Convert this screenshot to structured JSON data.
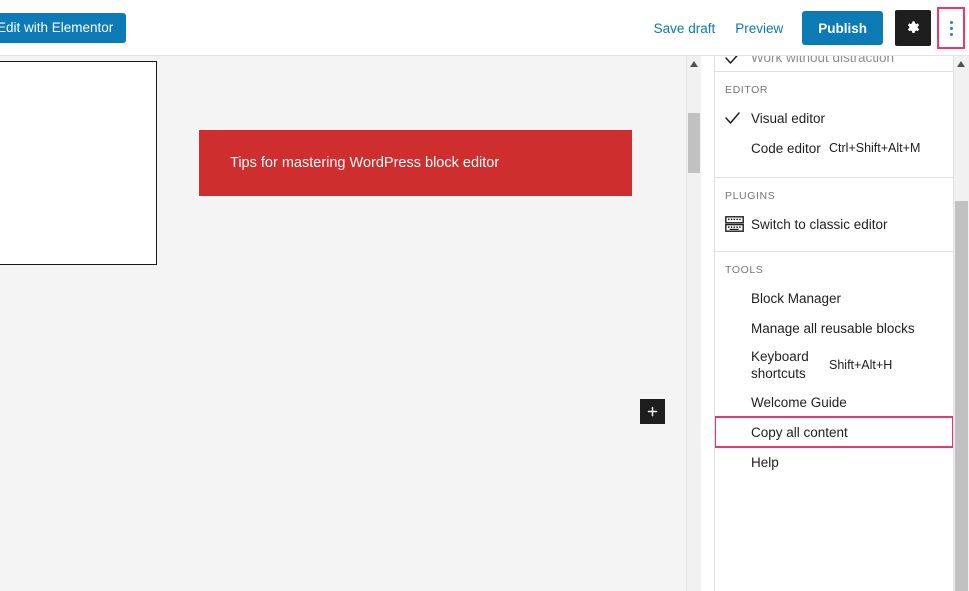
{
  "topbar": {
    "elementor_button": "Edit with Elementor",
    "save_draft": "Save draft",
    "preview": "Preview",
    "publish": "Publish",
    "settings_icon": "gear-icon",
    "more_menu_icon": "kebab-menu-icon"
  },
  "canvas": {
    "banner_text": "Tips for mastering WordPress block editor",
    "banner_color": "#cf2e2e",
    "background_color": "#f4f4f4",
    "add_block_icon": "plus-icon"
  },
  "menu": {
    "view_item": {
      "label": "Work without distraction",
      "checked": true
    },
    "sections": [
      {
        "title": "EDITOR",
        "items": [
          {
            "label": "Visual editor",
            "checked": true,
            "shortcut": ""
          },
          {
            "label": "Code editor",
            "checked": false,
            "shortcut": "Ctrl+Shift+Alt+M"
          }
        ]
      },
      {
        "title": "PLUGINS",
        "items": [
          {
            "label": "Switch to classic editor",
            "icon": "classic-editor-icon",
            "shortcut": ""
          }
        ]
      },
      {
        "title": "TOOLS",
        "items": [
          {
            "label": "Block Manager",
            "shortcut": ""
          },
          {
            "label": "Manage all reusable blocks",
            "shortcut": ""
          },
          {
            "label": "Keyboard shortcuts",
            "shortcut": "Shift+Alt+H"
          },
          {
            "label": "Welcome Guide",
            "shortcut": ""
          },
          {
            "label": "Copy all content",
            "shortcut": "",
            "highlighted": true
          },
          {
            "label": "Help",
            "shortcut": ""
          }
        ]
      }
    ]
  },
  "colors": {
    "accent_blue": "#0c7ab5",
    "highlight_pink": "#e8376f",
    "dark": "#1e1e1e"
  }
}
